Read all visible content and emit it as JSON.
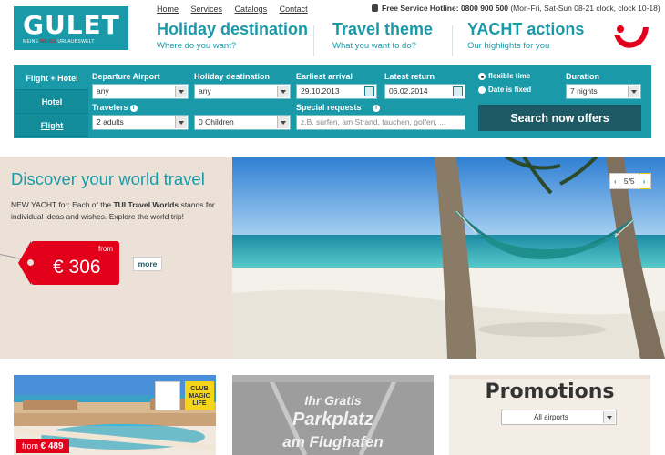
{
  "logo": {
    "main": "GULET",
    "sub_a": "MEINE ",
    "sub_b": "WEISS",
    "sub_c": " URLAUBSWELT"
  },
  "topnav": [
    "Home",
    "Services",
    "Catalogs",
    "Contact"
  ],
  "hotline": {
    "label": "Free Service Hotline:",
    "number": "0800 900 500",
    "hours": "(Mon-Fri, Sat-Sun 08-21 clock, clock 10-18)"
  },
  "mainnav": [
    {
      "title": "Holiday destination",
      "sub": "Where do you want?"
    },
    {
      "title": "Travel theme",
      "sub": "What you want to do?"
    },
    {
      "title": "YACHT actions",
      "sub": "Our highlights for you"
    }
  ],
  "search": {
    "tabs": [
      "Flight + Hotel",
      "Hotel",
      "Flight"
    ],
    "departure": {
      "label": "Departure Airport",
      "value": "any"
    },
    "destination": {
      "label": "Holiday destination",
      "value": "any"
    },
    "earliest": {
      "label": "Earliest arrival",
      "value": "29.10.2013"
    },
    "latest": {
      "label": "Latest return",
      "value": "06.02.2014"
    },
    "flexible": "flexible time",
    "fixed": "Date is fixed",
    "duration": {
      "label": "Duration",
      "value": "7 nights"
    },
    "travelers": {
      "label": "Travelers",
      "adults": "2 adults",
      "children": "0 Children"
    },
    "requests": {
      "label": "Special requests",
      "placeholder": "z.B. surfen, am Strand, tauchen, golfen, ..."
    },
    "button": "Search now offers"
  },
  "hero": {
    "title": "Discover your world travel",
    "text_a": "NEW YACHT for: Each of the ",
    "text_b": "TUI Travel Worlds",
    "text_c": " stands for individual ideas and wishes. Explore the world trip!",
    "price_from": "from",
    "price": "€ 306",
    "more": "more",
    "slider_pos": "5/5",
    "prev": "‹",
    "next": "›"
  },
  "teasers": {
    "price_from": "from",
    "price": "€ 489",
    "club_badge": "CLUB MAGIC LIFE",
    "parking": [
      "Ihr Gratis",
      "Parkplatz",
      "am Flughafen"
    ],
    "promotions_title": "Promotions",
    "airports": "All airports"
  },
  "colors": {
    "brand": "#1a9aa9",
    "dark_button": "#1e5a66",
    "price_red": "#e3001b",
    "sand": "#ebe1d6"
  }
}
